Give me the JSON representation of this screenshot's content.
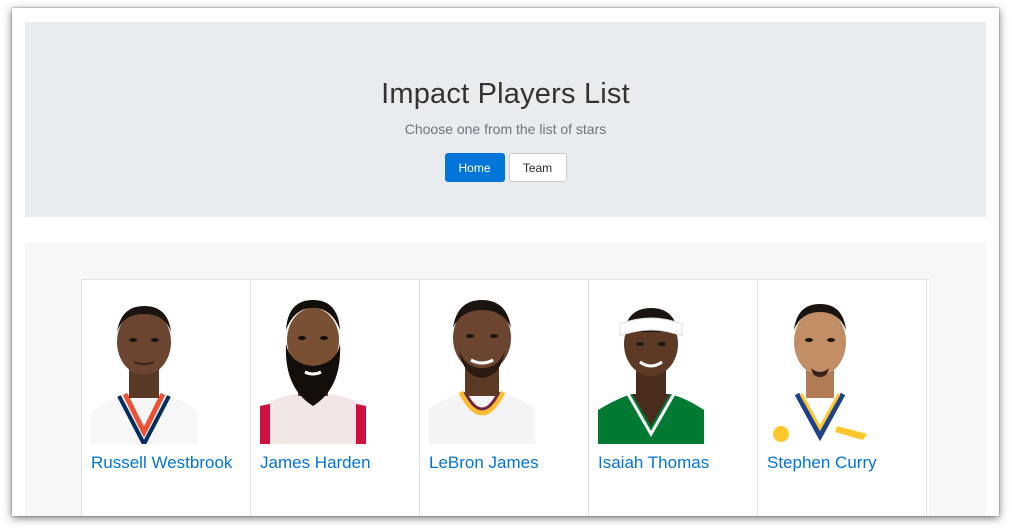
{
  "header": {
    "title": "Impact Players List",
    "lead": "Choose one from the list of stars",
    "buttons": {
      "home": "Home",
      "team": "Team"
    }
  },
  "colors": {
    "primary": "#0275d8",
    "jumbotron_bg": "#e9ecef",
    "album_bg": "#f7f7f7"
  },
  "players": [
    {
      "name": "Russell Westbrook",
      "jersey": "#ffffff",
      "trim": "#f05133",
      "trim2": "#002d62",
      "icon": "player-photo"
    },
    {
      "name": "James Harden",
      "jersey": "#f2e6e6",
      "trim": "#ce1141",
      "trim2": "#ce1141",
      "icon": "player-photo"
    },
    {
      "name": "LeBron James",
      "jersey": "#f4f4f6",
      "trim": "#fdbb30",
      "trim2": "#6f263d",
      "icon": "player-photo"
    },
    {
      "name": "Isaiah Thomas",
      "jersey": "#007a33",
      "trim": "#ffffff",
      "trim2": "#007a33",
      "icon": "player-photo"
    },
    {
      "name": "Stephen Curry",
      "jersey": "#ffffff",
      "trim": "#1d428a",
      "trim2": "#ffc72c",
      "icon": "player-photo"
    }
  ]
}
